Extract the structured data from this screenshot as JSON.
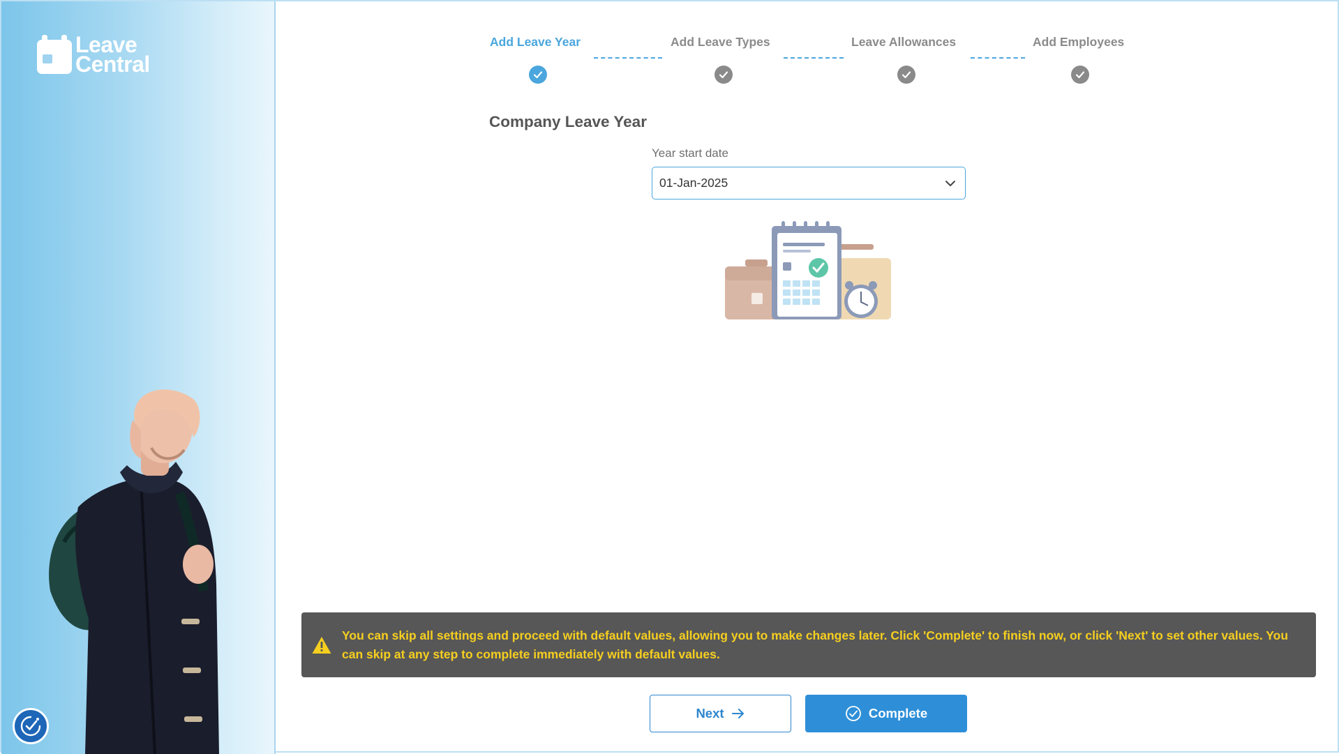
{
  "brand": {
    "line1": "Leave",
    "line2": "Central"
  },
  "stepper": {
    "steps": [
      {
        "label": "Add Leave Year",
        "state": "active"
      },
      {
        "label": "Add Leave Types",
        "state": "pending"
      },
      {
        "label": "Leave Allowances",
        "state": "pending"
      },
      {
        "label": "Add Employees",
        "state": "pending"
      }
    ]
  },
  "form": {
    "section_title": "Company Leave Year",
    "year_start_label": "Year start date",
    "year_start_value": "01-Jan-2025"
  },
  "notice": {
    "text": "You can skip all settings and proceed with default values, allowing you to make changes later. Click 'Complete' to finish now, or click 'Next' to set other values. You can skip at any step to complete immediately with default values."
  },
  "actions": {
    "next_label": "Next",
    "complete_label": "Complete"
  },
  "colors": {
    "accent": "#4aa6dd",
    "primary_button": "#2e8fd8",
    "warning_text": "#f6cf1f",
    "notice_bg": "#575757"
  },
  "icons": [
    "calendar-logo-icon",
    "check-icon",
    "chevron-down-icon",
    "warning-icon",
    "arrow-right-icon",
    "check-circle-icon",
    "accessibility-icon"
  ]
}
